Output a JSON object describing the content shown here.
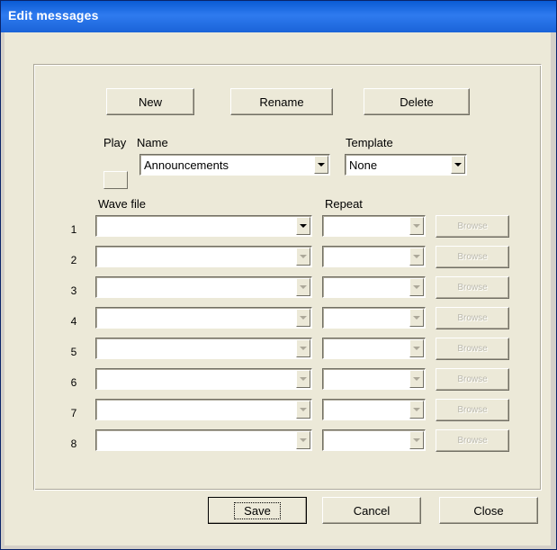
{
  "window": {
    "title": "Edit messages"
  },
  "toolbar": {
    "new_label": "New",
    "rename_label": "Rename",
    "delete_label": "Delete"
  },
  "labels": {
    "play": "Play",
    "name": "Name",
    "template": "Template",
    "wave_file": "Wave file",
    "repeat": "Repeat"
  },
  "name_select": {
    "value": "Announcements"
  },
  "template_select": {
    "value": "None"
  },
  "rows": [
    {
      "number": "1",
      "wave_file": "",
      "repeat": "",
      "button_label": "Browse"
    },
    {
      "number": "2",
      "wave_file": "",
      "repeat": "",
      "button_label": "Browse"
    },
    {
      "number": "3",
      "wave_file": "",
      "repeat": "",
      "button_label": "Browse"
    },
    {
      "number": "4",
      "wave_file": "",
      "repeat": "",
      "button_label": "Browse"
    },
    {
      "number": "5",
      "wave_file": "",
      "repeat": "",
      "button_label": "Browse"
    },
    {
      "number": "6",
      "wave_file": "",
      "repeat": "",
      "button_label": "Browse"
    },
    {
      "number": "7",
      "wave_file": "",
      "repeat": "",
      "button_label": "Browse"
    },
    {
      "number": "8",
      "wave_file": "",
      "repeat": "",
      "button_label": "Browse"
    }
  ],
  "footer": {
    "save_label": "Save",
    "cancel_label": "Cancel",
    "close_label": "Close"
  }
}
